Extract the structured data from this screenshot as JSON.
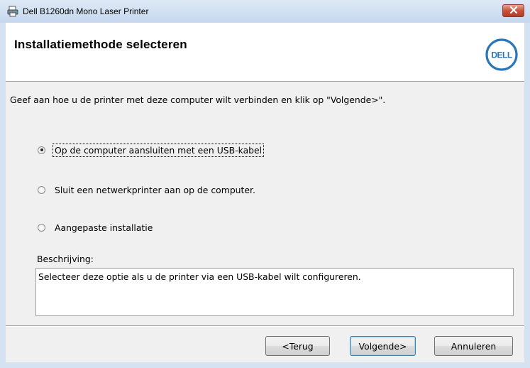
{
  "window": {
    "title": "Dell B1260dn Mono Laser Printer",
    "close_glyph": "✕"
  },
  "header": {
    "title": "Installatiemethode selecteren",
    "logo_text": "DELL",
    "logo_color": "#2a76b8"
  },
  "main": {
    "instruction": "Geef aan hoe u de printer met deze computer wilt verbinden en klik op \"Volgende>\".",
    "options": [
      {
        "label": "Op de computer aansluiten met een USB-kabel",
        "selected": true
      },
      {
        "label": "Sluit een netwerkprinter aan op de computer.",
        "selected": false
      },
      {
        "label": "Aangepaste installatie",
        "selected": false
      }
    ],
    "description_label": "Beschrijving:",
    "description_text": "Selecteer deze optie als u de printer via een USB-kabel wilt configureren."
  },
  "footer": {
    "back_label": "<Terug",
    "next_label": "Volgende>",
    "cancel_label": "Annuleren"
  },
  "icons": {
    "app": "printer-icon",
    "close": "close-icon"
  }
}
